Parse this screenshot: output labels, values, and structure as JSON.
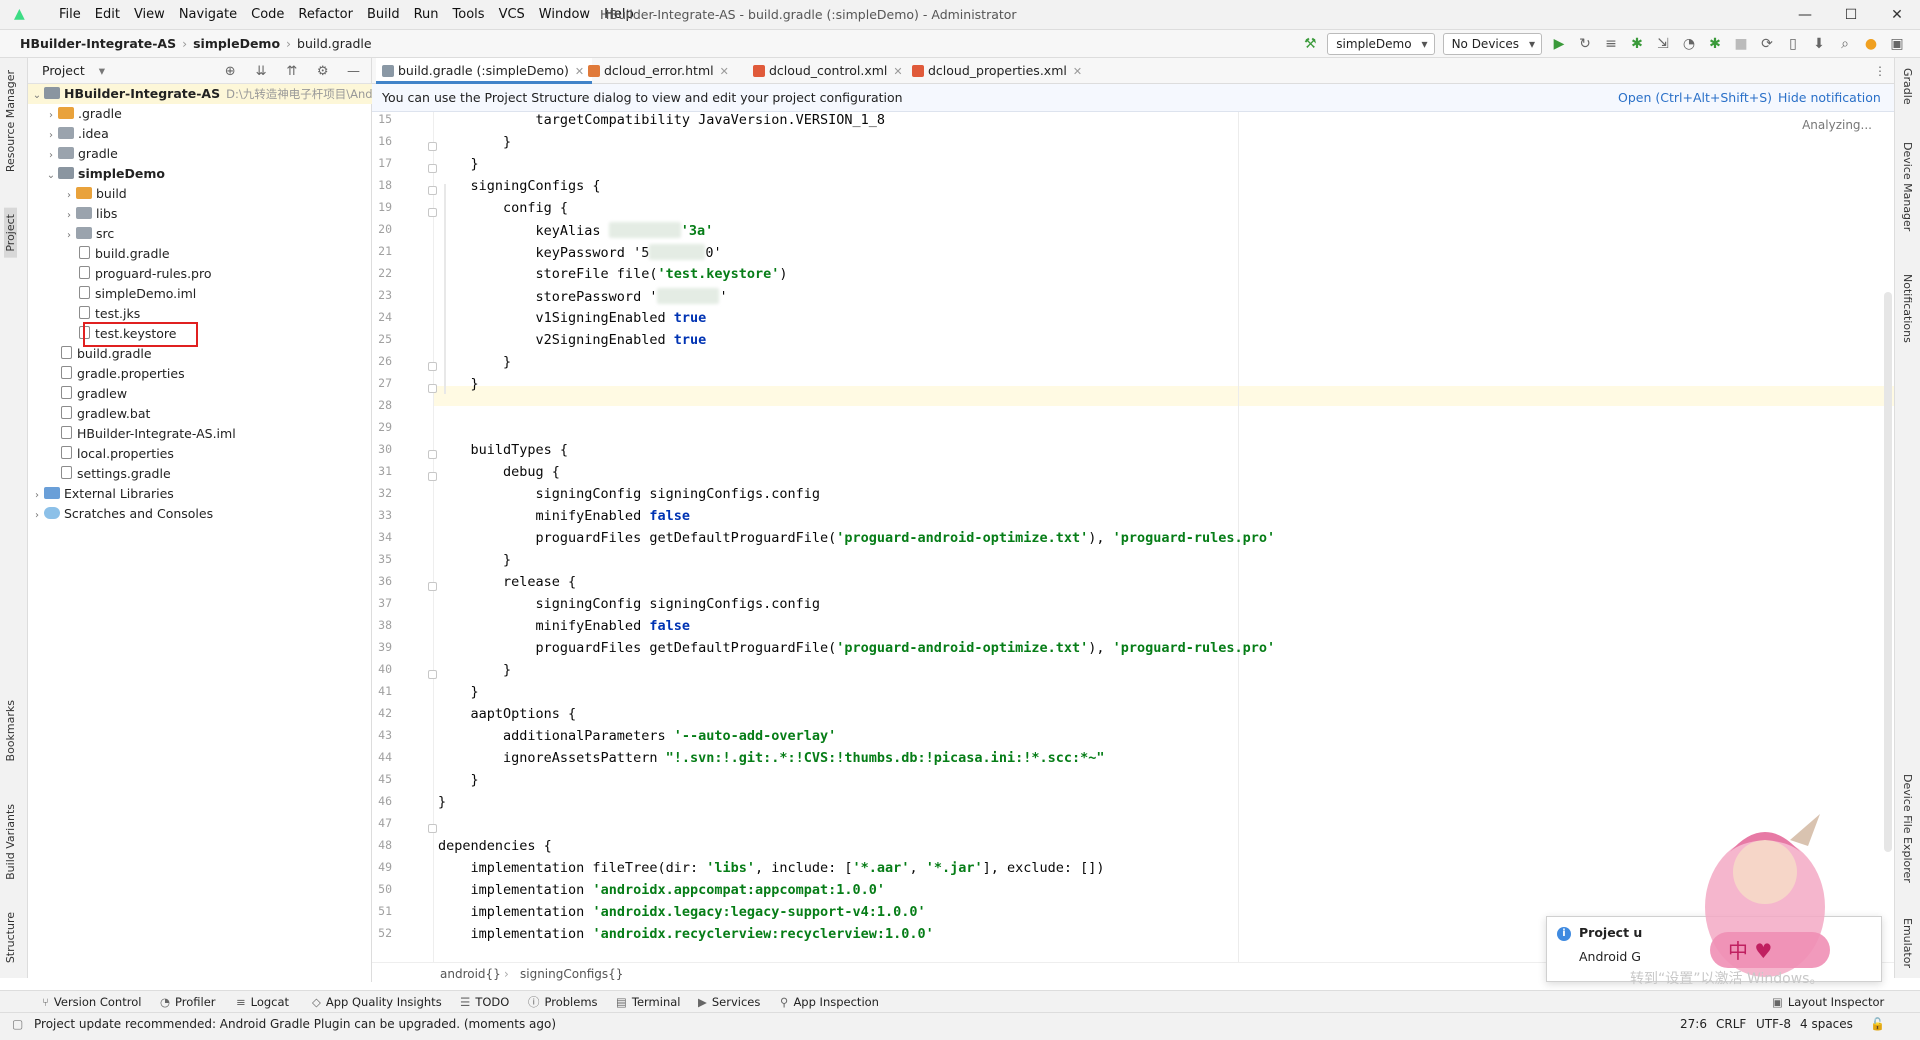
{
  "app": {
    "menu": [
      "File",
      "Edit",
      "View",
      "Navigate",
      "Code",
      "Refactor",
      "Build",
      "Run",
      "Tools",
      "VCS",
      "Window",
      "Help"
    ],
    "window_title": "HBuilder-Integrate-AS - build.gradle (:simpleDemo) - Administrator",
    "minimize": "—",
    "maximize": "☐",
    "close": "✕"
  },
  "navbar": {
    "breadcrumb": [
      "HBuilder-Integrate-AS",
      "simpleDemo",
      "build.gradle"
    ],
    "run_config": "simpleDemo",
    "device": "No Devices"
  },
  "left_stripe": {
    "resource_manager": "Resource Manager",
    "project": "Project",
    "bookmarks": "Bookmarks",
    "build_variants": "Build Variants",
    "structure": "Structure"
  },
  "right_stripe": {
    "gradle": "Gradle",
    "device_manager": "Device Manager",
    "notifications": "Notifications",
    "device_file_explorer": "Device File Explorer",
    "emulator": "Emulator"
  },
  "project_panel": {
    "title": "Project",
    "root_label": "HBuilder-Integrate-AS",
    "root_path": "D:\\九转造神电子杆项目\\Andro",
    "items": [
      {
        "label": ".gradle"
      },
      {
        "label": ".idea"
      },
      {
        "label": "gradle"
      },
      {
        "label": "simpleDemo"
      },
      {
        "label": "build"
      },
      {
        "label": "libs"
      },
      {
        "label": "src"
      },
      {
        "label": "build.gradle"
      },
      {
        "label": "proguard-rules.pro"
      },
      {
        "label": "simpleDemo.iml"
      },
      {
        "label": "test.jks"
      },
      {
        "label": "test.keystore"
      },
      {
        "label": "build.gradle"
      },
      {
        "label": "gradle.properties"
      },
      {
        "label": "gradlew"
      },
      {
        "label": "gradlew.bat"
      },
      {
        "label": "HBuilder-Integrate-AS.iml"
      },
      {
        "label": "local.properties"
      },
      {
        "label": "settings.gradle"
      },
      {
        "label": "External Libraries"
      },
      {
        "label": "Scratches and Consoles"
      }
    ]
  },
  "tabs": [
    {
      "label": "build.gradle (:simpleDemo)"
    },
    {
      "label": "dcloud_error.html"
    },
    {
      "label": "dcloud_control.xml"
    },
    {
      "label": "dcloud_properties.xml"
    }
  ],
  "notification": {
    "message": "You can use the Project Structure dialog to view and edit your project configuration",
    "open_link": "Open (Ctrl+Alt+Shift+S)",
    "hide_link": "Hide notification"
  },
  "editor": {
    "analyzing": "Analyzing...",
    "line_numbers": [
      "15",
      "16",
      "17",
      "18",
      "19",
      "20",
      "21",
      "22",
      "23",
      "24",
      "25",
      "26",
      "27",
      "28",
      "29",
      "30",
      "31",
      "32",
      "33",
      "34",
      "35",
      "36",
      "37",
      "38",
      "39",
      "40",
      "41",
      "42",
      "43",
      "44",
      "45",
      "46",
      "47",
      "48",
      "49",
      "50",
      "51",
      "52"
    ],
    "code": {
      "l15a": "            targetCompatibility JavaVersion.VERSION_1_8",
      "l16": "        }",
      "l17": "    }",
      "l18": "    signingConfigs {",
      "l19": "        config {",
      "l20a": "            keyAlias ",
      "l20b": "'3a'",
      "l21a": "            keyPassword '5",
      "l21b": "0'",
      "l22a": "            storeFile file(",
      "l22b": "'test.keystore'",
      "l22c": ")",
      "l23a": "            storePassword '",
      "l23b": "'",
      "l24a": "            v1SigningEnabled ",
      "l24b": "true",
      "l25a": "            v2SigningEnabled ",
      "l25b": "true",
      "l26": "        }",
      "l27": "    }",
      "l30": "    buildTypes {",
      "l31": "        debug {",
      "l32": "            signingConfig signingConfigs.config",
      "l33a": "            minifyEnabled ",
      "l33b": "false",
      "l34a": "            proguardFiles getDefaultProguardFile(",
      "l34b": "'proguard-android-optimize.txt'",
      "l34c": "), ",
      "l34d": "'proguard-rules.pro'",
      "l35": "        }",
      "l36": "        release {",
      "l37": "            signingConfig signingConfigs.config",
      "l38a": "            minifyEnabled ",
      "l38b": "false",
      "l39a": "            proguardFiles getDefaultProguardFile(",
      "l39b": "'proguard-android-optimize.txt'",
      "l39c": "), ",
      "l39d": "'proguard-rules.pro'",
      "l40": "        }",
      "l41": "    }",
      "l42": "    aaptOptions {",
      "l43a": "        additionalParameters ",
      "l43b": "'--auto-add-overlay'",
      "l44a": "        ignoreAssetsPattern ",
      "l44b": "\"!.svn:!.git:.*:!CVS:!thumbs.db:!picasa.ini:!*.scc:*~\"",
      "l45": "    }",
      "l46": "}",
      "l48": "dependencies {",
      "l49a": "    implementation fileTree(dir: ",
      "l49b": "'libs'",
      "l49c": ", include: [",
      "l49d": "'*.aar'",
      "l49e": ", ",
      "l49f": "'*.jar'",
      "l49g": "], exclude: [])",
      "l50a": "    implementation ",
      "l50b": "'androidx.appcompat:appcompat:1.0.0'",
      "l51a": "    implementation ",
      "l51b": "'androidx.legacy:legacy-support-v4:1.0.0'",
      "l52a": "    implementation ",
      "l52b": "'androidx.recyclerview:recyclerview:1.0.0'"
    },
    "breadcrumb": [
      "android{}",
      "signingConfigs{}"
    ]
  },
  "bottom_tools": [
    "Version Control",
    "Profiler",
    "Logcat",
    "App Quality Insights",
    "TODO",
    "Problems",
    "Terminal",
    "Services",
    "App Inspection",
    "Layout Inspector"
  ],
  "status": {
    "message": "Project update recommended: Android Gradle Plugin can be upgraded. (moments ago)",
    "position": "27:6",
    "line_sep": "CRLF",
    "encoding": "UTF-8",
    "indent": "4 spaces"
  },
  "popup": {
    "title": "Project u",
    "body": "Android G"
  },
  "watermark": "转到“设置”以激活 Windows。"
}
